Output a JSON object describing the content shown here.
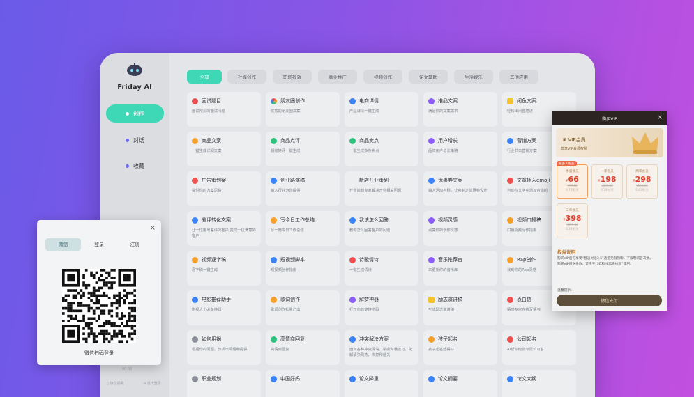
{
  "app": {
    "name": "Friday AI"
  },
  "nav": [
    {
      "label": "创作",
      "active": true
    },
    {
      "label": "对话",
      "active": false
    },
    {
      "label": "收藏",
      "active": false
    }
  ],
  "footer": {
    "left": "协议说明",
    "right": "退出登录",
    "version": "00:02"
  },
  "tabs": [
    {
      "label": "全部",
      "active": true
    },
    {
      "label": "社媒创作"
    },
    {
      "label": "职场提效"
    },
    {
      "label": "商业推广"
    },
    {
      "label": "视频创作"
    },
    {
      "label": "论文辅助"
    },
    {
      "label": "生活娱乐"
    },
    {
      "label": "其他应用"
    }
  ],
  "cards": [
    [
      {
        "title": "面试题目",
        "desc": "面试常见的面试问题",
        "icon": "red"
      },
      {
        "title": "朋友圈创作",
        "desc": "优秀的朋友圈文案",
        "icon": "multicolor"
      },
      {
        "title": "电商详情",
        "desc": "产品详情一键生成",
        "icon": "blue"
      },
      {
        "title": "推品文案",
        "desc": "满足你的文案需求",
        "icon": "purple"
      },
      {
        "title": "闲鱼文案",
        "desc": "轻松出闲鱼描述",
        "icon": "yellow"
      }
    ],
    [
      {
        "title": "商品文案",
        "desc": "一键生成详细文案",
        "icon": "orange"
      },
      {
        "title": "商品点评",
        "desc": "超级好评一键生成",
        "icon": "green"
      },
      {
        "title": "商品卖点",
        "desc": "一键生成多条卖点",
        "icon": "green"
      },
      {
        "title": "用户增长",
        "desc": "品牌用户增长策略",
        "icon": "purple"
      },
      {
        "title": "营销方案",
        "desc": "行业节日营销方案",
        "icon": "blue"
      }
    ],
    [
      {
        "title": "广告策划案",
        "desc": "提供你的方案思路",
        "icon": "red"
      },
      {
        "title": "创业路演稿",
        "desc": "输入行业为您提供",
        "icon": "blue"
      },
      {
        "title": "新店开业策划",
        "desc": "开业策划专家解决开业相关问题",
        "icon": "none"
      },
      {
        "title": "优惠券文案",
        "desc": "输入活动名称，让AI制定优惠卷设计",
        "icon": "blue"
      },
      {
        "title": "文章插入emoji",
        "desc": "自动在文字中添加合适的",
        "icon": "red"
      }
    ],
    [
      {
        "title": "差评转化文案",
        "desc": "让一位抱出差评的客户 变成一位满意的客户",
        "icon": "blue"
      },
      {
        "title": "写今日工作总结",
        "desc": "写一篇今日工作总结",
        "icon": "orange"
      },
      {
        "title": "我该怎么回答",
        "desc": "教你怎么回答客户的问题",
        "icon": "blue"
      },
      {
        "title": "视频灵感",
        "desc": "点亮你的创作灵感",
        "icon": "purple"
      },
      {
        "title": "视频口播稿",
        "desc": "口播视频写作指南",
        "icon": "orange"
      }
    ],
    [
      {
        "title": "视频逐字稿",
        "desc": "逐字稿一键生成",
        "icon": "orange"
      },
      {
        "title": "短视频脚本",
        "desc": "短视频创作指南",
        "icon": "blue"
      },
      {
        "title": "诗歌情诗",
        "desc": "一键生成情诗",
        "icon": "red"
      },
      {
        "title": "音乐推荐官",
        "desc": "来更新你的音乐库",
        "icon": "purple"
      },
      {
        "title": "Rap创作",
        "desc": "找到你的Rap灵感",
        "icon": "orange"
      }
    ],
    [
      {
        "title": "电影推荐助手",
        "desc": "影视人士必备神器",
        "icon": "blue"
      },
      {
        "title": "歌词创作",
        "desc": "歌词创作批量产出",
        "icon": "orange"
      },
      {
        "title": "解梦神器",
        "desc": "打开你的梦境密码",
        "icon": "purple"
      },
      {
        "title": "励志演讲稿",
        "desc": "生成励志演讲稿",
        "icon": "yellow"
      },
      {
        "title": "表白信",
        "desc": "情感专家在线写情书",
        "icon": "red"
      }
    ],
    [
      {
        "title": "如何用锅",
        "desc": "根据你的问题，分析出问题和提供",
        "icon": "gray"
      },
      {
        "title": "高情商回复",
        "desc": "高情商回复",
        "icon": "green"
      },
      {
        "title": "冲突解决方案",
        "desc": "面对各种冲突情境，学会沟通技巧，化解紧张局势，恢复和谐关",
        "icon": "blue"
      },
      {
        "title": "孩子起名",
        "desc": "孩子起名起得好",
        "icon": "orange"
      },
      {
        "title": "公司起名",
        "desc": "AI帮你给你专属公司名",
        "icon": "red"
      }
    ],
    [
      {
        "title": "职业规划",
        "desc": "",
        "icon": "gray"
      },
      {
        "title": "中国好妈",
        "desc": "",
        "icon": "blue"
      },
      {
        "title": "论文降重",
        "desc": "",
        "icon": "blue"
      },
      {
        "title": "论文摘要",
        "desc": "",
        "icon": "blue"
      },
      {
        "title": "论文大纲",
        "desc": "",
        "icon": "blue"
      }
    ]
  ],
  "login": {
    "tabs": [
      {
        "label": "微信",
        "active": true
      },
      {
        "label": "登录"
      },
      {
        "label": "注册"
      }
    ],
    "caption": "微信扫码登录",
    "close": "×"
  },
  "vip": {
    "title": "购买VIP",
    "close": "×",
    "badge": "VIP会员",
    "subtitle": "尊享VIP会员权益",
    "plans": [
      {
        "tag": "最多人购买",
        "name": "季度会员",
        "price": "66",
        "old": "¥99.00",
        "per": "0.73元/天",
        "selected": true
      },
      {
        "name": "一年会员",
        "price": "198",
        "old": "¥399.00",
        "per": "0.54元/天"
      },
      {
        "name": "两年会员",
        "price": "298",
        "old": "¥599.00",
        "per": "0.41元/天"
      },
      {
        "name": "三年会员",
        "price": "398",
        "old": "¥899.00",
        "per": "0.36元/天"
      }
    ],
    "currency": "¥",
    "rights_title": "权益说明",
    "rights": [
      "购买VIP后可享受“普通对话3.5”通道无限畅聊，不限制问答次数。",
      "购买VIP赠送条数，可用于“SD和MJ高级绘图”使用。"
    ],
    "tip": "温馨提示:",
    "pay": "微信支付"
  },
  "colors": {
    "accent": "#3fd8b6",
    "red": "#ef4f4f",
    "orange": "#f5a02a",
    "yellow": "#f2c52b",
    "green": "#2ec27e",
    "blue": "#3b82f6",
    "purple": "#8b5cf6",
    "multicolor": "#ff8a3d",
    "gray": "#8a8f98",
    "none": "transparent"
  }
}
